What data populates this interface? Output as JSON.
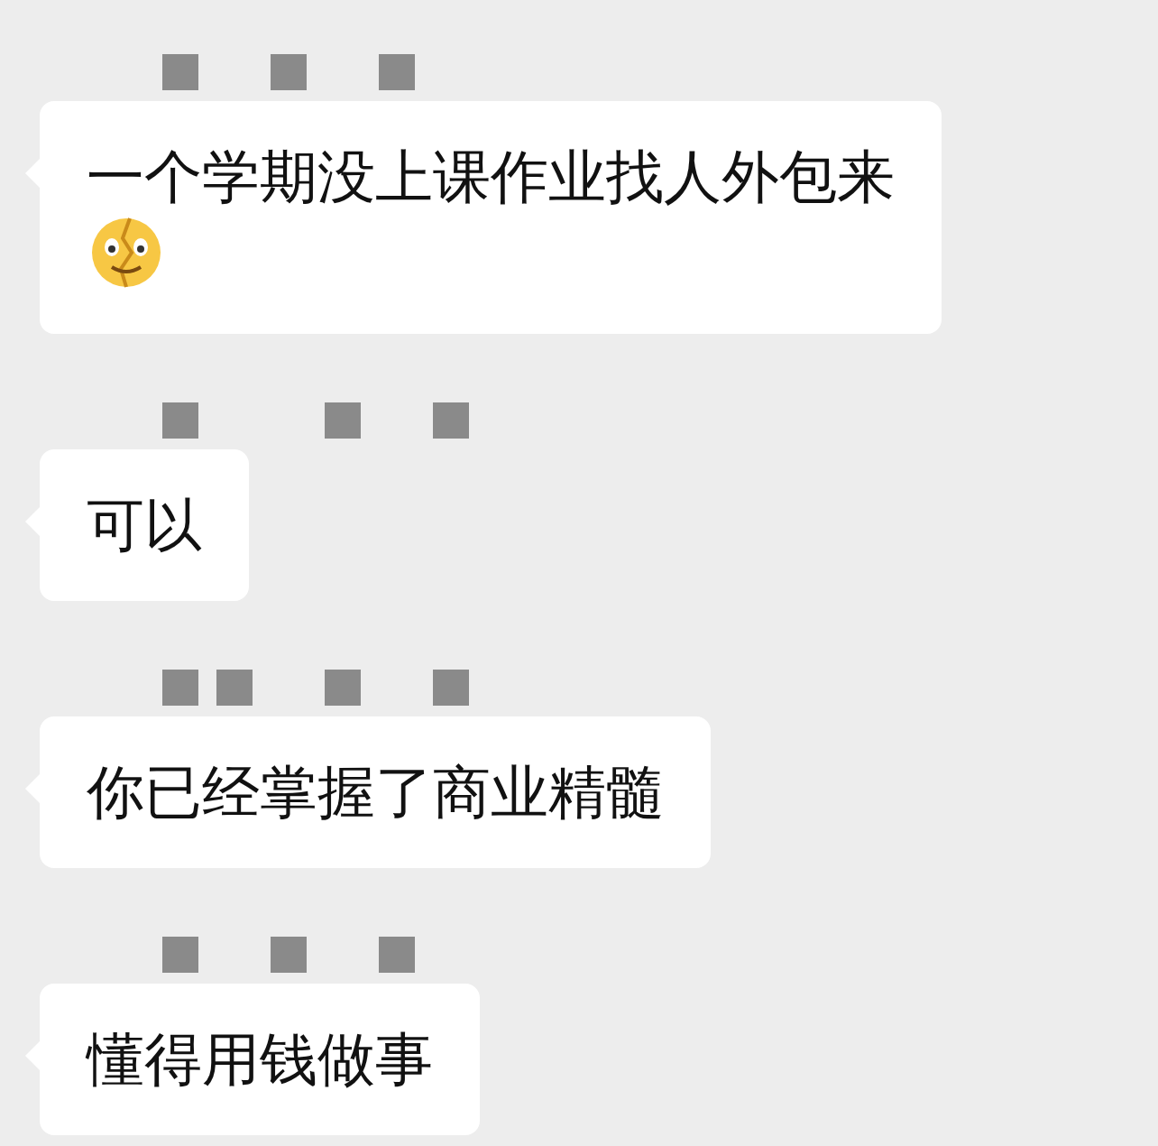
{
  "messages": [
    {
      "sender_obscured": true,
      "text": "一个学期没上课作业找人外包来",
      "emoji": true
    },
    {
      "sender_obscured": true,
      "text": "可以",
      "emoji": false
    },
    {
      "sender_obscured": true,
      "text": "你已经掌握了商业精髓",
      "emoji": false
    },
    {
      "sender_obscured": true,
      "text": "懂得用钱做事",
      "emoji": false
    }
  ]
}
